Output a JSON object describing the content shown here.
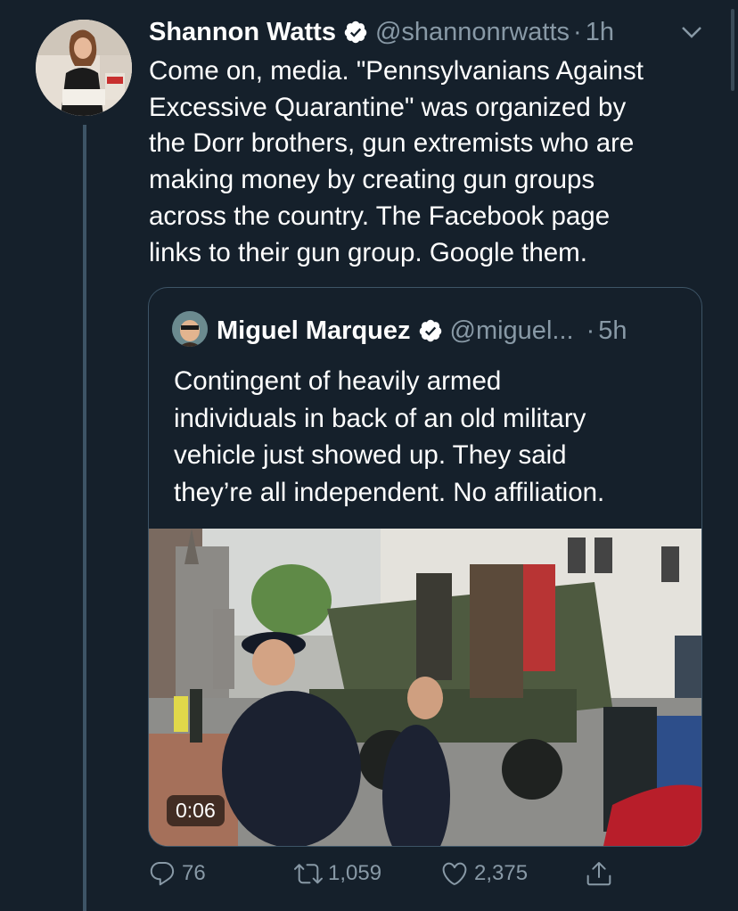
{
  "tweet": {
    "author_name": "Shannon Watts",
    "handle": "@shannonrwatts",
    "separator": "·",
    "time": "1h",
    "text": "Come on, media. \"Pennsylvanians Against\nExcessive Quarantine\" was organized by\nthe Dorr brothers, gun extremists who are\nmaking money by creating gun groups\nacross the country. The Facebook page\nlinks to their gun group. Google them."
  },
  "quote": {
    "author_name": "Miguel Marquez",
    "handle": "@miguel...",
    "separator": "·",
    "time": "5h",
    "text": "Contingent of heavily armed\nindividuals in back of an old military\nvehicle just showed up.  They said\nthey’re all independent.  No affiliation.",
    "video_duration": "0:06"
  },
  "actions": {
    "replies": "76",
    "retweets": "1,059",
    "likes": "2,375"
  },
  "colors": {
    "background": "#15202b",
    "secondary_text": "#8899a6",
    "border": "#3d5466",
    "verified": "#ffffff"
  },
  "icons": [
    "verified-icon",
    "chevron-down-icon",
    "reply-icon",
    "retweet-icon",
    "like-icon",
    "share-icon"
  ]
}
